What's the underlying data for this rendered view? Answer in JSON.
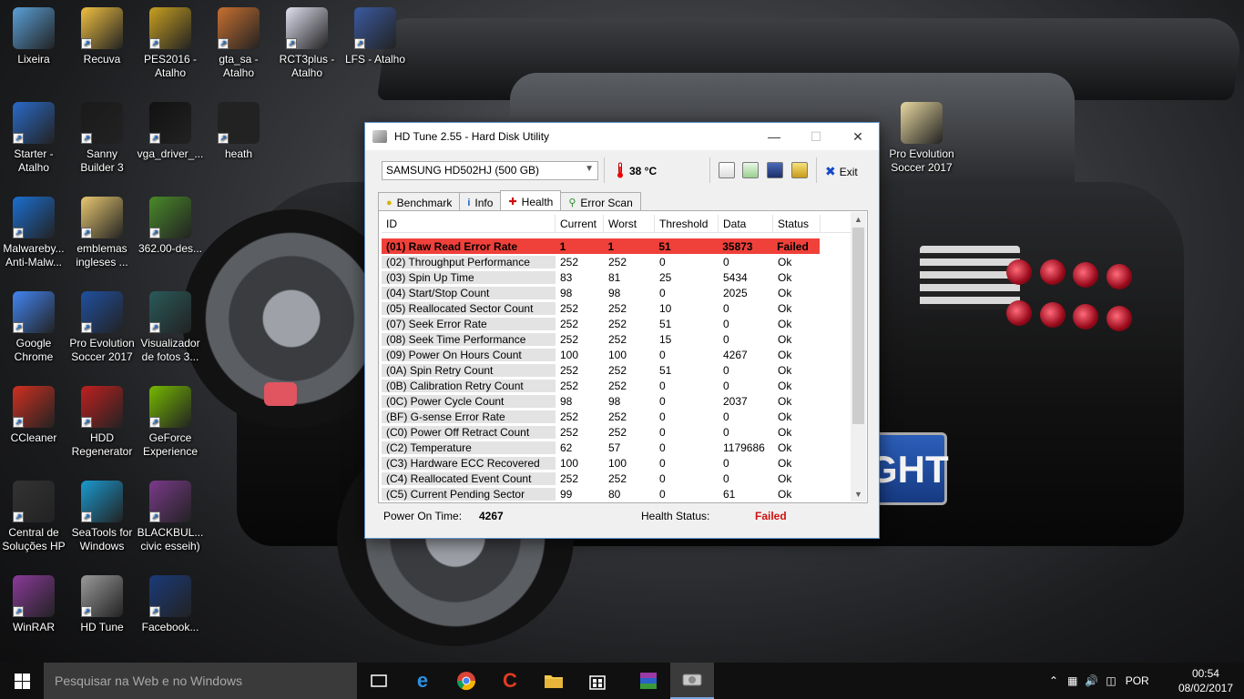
{
  "desktop": {
    "icons": [
      {
        "label": "Lixeira",
        "icon": "recycle-bin-icon",
        "color": "#5aa0d8"
      },
      {
        "label": "Recuva",
        "icon": "recuva-icon",
        "color": "#f0c040"
      },
      {
        "label": "PES2016 - Atalho",
        "icon": "pes2016-icon",
        "color": "#c8a020"
      },
      {
        "label": "gta_sa - Atalho",
        "icon": "gta-icon",
        "color": "#c87030"
      },
      {
        "label": "RCT3plus - Atalho",
        "icon": "rct3-icon",
        "color": "#e0e0f0"
      },
      {
        "label": "LFS - Atalho",
        "icon": "lfs-icon",
        "color": "#3a5aa0"
      },
      {
        "label": "Starter - Atalho",
        "icon": "starter-3d-icon",
        "color": "#2a6ac8"
      },
      {
        "label": "Sanny Builder 3",
        "icon": "sanny-builder-icon",
        "color": "#1a1a1a"
      },
      {
        "label": "vga_driver_...",
        "icon": "7zip-icon",
        "color": "#111111"
      },
      {
        "label": "heath",
        "icon": "battery-icon",
        "color": "#222222"
      },
      {
        "label": "Malwareby... Anti-Malw...",
        "icon": "malwarebytes-icon",
        "color": "#1b6fd1"
      },
      {
        "label": "emblemas ingleses ...",
        "icon": "folder-icon",
        "color": "#e8c870"
      },
      {
        "label": "362.00-des...",
        "icon": "nvidia-installer-icon",
        "color": "#4a8a2a"
      },
      {
        "label": "Google Chrome",
        "icon": "chrome-icon",
        "color": "#4285f4"
      },
      {
        "label": "Pro Evolution Soccer 2017",
        "icon": "pes2017-icon",
        "color": "#2050a0"
      },
      {
        "label": "Visualizador de fotos 3...",
        "icon": "photo-viewer-icon",
        "color": "#2a5a5a"
      },
      {
        "label": "CCleaner",
        "icon": "ccleaner-icon",
        "color": "#d03020"
      },
      {
        "label": "HDD Regenerator",
        "icon": "hdd-regenerator-icon",
        "color": "#c02020"
      },
      {
        "label": "GeForce Experience",
        "icon": "geforce-icon",
        "color": "#76b900"
      },
      {
        "label": "Central de Soluções HP",
        "icon": "hp-icon",
        "color": "#333333"
      },
      {
        "label": "SeaTools for Windows",
        "icon": "seatools-icon",
        "color": "#1a9ad0"
      },
      {
        "label": "BLACKBUL... civic esseih)",
        "icon": "winrar-archive-icon",
        "color": "#7a3a8a"
      },
      {
        "label": "WinRAR",
        "icon": "winrar-icon",
        "color": "#8a3a9a"
      },
      {
        "label": "HD Tune",
        "icon": "hdtune-icon",
        "color": "#9a9a9a"
      },
      {
        "label": "Facebook...",
        "icon": "facebook-app-icon",
        "color": "#1a3a7a"
      },
      {
        "label": "Pro Evolution Soccer 2017",
        "icon": "folder-icon",
        "color": "#e8d8a0"
      }
    ],
    "plate_text": "GHT"
  },
  "window": {
    "title": "HD Tune 2.55 - Hard Disk Utility",
    "drive": "SAMSUNG HD502HJ (500 GB)",
    "temperature": "38 °C",
    "exit_label": "Exit",
    "tabs": [
      {
        "label": "Benchmark",
        "icon": "lightbulb-icon"
      },
      {
        "label": "Info",
        "icon": "info-icon"
      },
      {
        "label": "Health",
        "icon": "health-cross-icon"
      },
      {
        "label": "Error Scan",
        "icon": "magnifier-icon"
      }
    ],
    "health": {
      "columns": [
        "ID",
        "Current",
        "Worst",
        "Threshold",
        "Data",
        "Status"
      ],
      "rows": [
        [
          "(01) Raw Read Error Rate",
          "1",
          "1",
          "51",
          "35873",
          "Failed"
        ],
        [
          "(02) Throughput Performance",
          "252",
          "252",
          "0",
          "0",
          "Ok"
        ],
        [
          "(03) Spin Up Time",
          "83",
          "81",
          "25",
          "5434",
          "Ok"
        ],
        [
          "(04) Start/Stop Count",
          "98",
          "98",
          "0",
          "2025",
          "Ok"
        ],
        [
          "(05) Reallocated Sector Count",
          "252",
          "252",
          "10",
          "0",
          "Ok"
        ],
        [
          "(07) Seek Error Rate",
          "252",
          "252",
          "51",
          "0",
          "Ok"
        ],
        [
          "(08) Seek Time Performance",
          "252",
          "252",
          "15",
          "0",
          "Ok"
        ],
        [
          "(09) Power On Hours Count",
          "100",
          "100",
          "0",
          "4267",
          "Ok"
        ],
        [
          "(0A) Spin Retry Count",
          "252",
          "252",
          "51",
          "0",
          "Ok"
        ],
        [
          "(0B) Calibration Retry Count",
          "252",
          "252",
          "0",
          "0",
          "Ok"
        ],
        [
          "(0C) Power Cycle Count",
          "98",
          "98",
          "0",
          "2037",
          "Ok"
        ],
        [
          "(BF) G-sense Error Rate",
          "252",
          "252",
          "0",
          "0",
          "Ok"
        ],
        [
          "(C0) Power Off Retract Count",
          "252",
          "252",
          "0",
          "0",
          "Ok"
        ],
        [
          "(C2) Temperature",
          "62",
          "57",
          "0",
          "1179686",
          "Ok"
        ],
        [
          "(C3) Hardware ECC Recovered",
          "100",
          "100",
          "0",
          "0",
          "Ok"
        ],
        [
          "(C4) Reallocated Event Count",
          "252",
          "252",
          "0",
          "0",
          "Ok"
        ],
        [
          "(C5) Current Pending Sector",
          "99",
          "80",
          "0",
          "61",
          "Ok"
        ]
      ],
      "failed_color": "#f0403a"
    },
    "footer": {
      "power_on_label": "Power On Time:",
      "power_on_value": "4267",
      "health_label": "Health Status:",
      "health_value": "Failed",
      "health_color": "#d01010"
    }
  },
  "taskbar": {
    "search_placeholder": "Pesquisar na Web e no Windows",
    "apps": [
      "task-view-icon",
      "edge-icon",
      "chrome-icon",
      "ccleaner-icon",
      "file-explorer-icon",
      "store-icon",
      "winrar-icon",
      "hdtune-icon"
    ],
    "language": "POR",
    "time": "00:54",
    "date": "08/02/2017"
  }
}
